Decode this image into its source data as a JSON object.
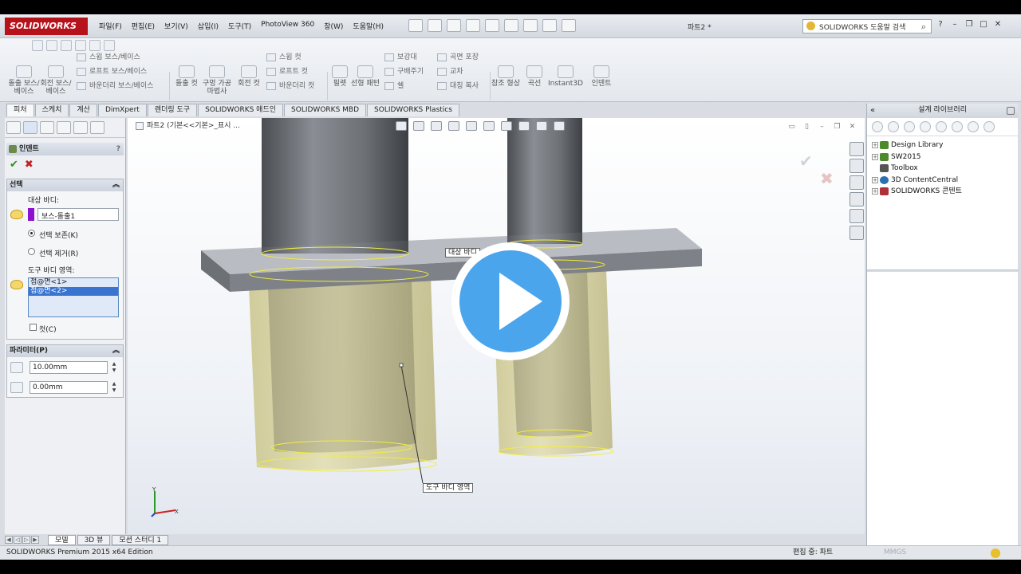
{
  "app": {
    "logo_text": "SOLIDWORKS",
    "doc_title": "파트2 *",
    "search_placeholder": "SOLIDWORKS 도움말 검색"
  },
  "menu": [
    "파일(F)",
    "편집(E)",
    "보기(V)",
    "삽입(I)",
    "도구(T)",
    "PhotoView 360",
    "창(W)",
    "도움말(H)"
  ],
  "ribbon": {
    "big": [
      {
        "label": "돌출 보스/베이스"
      },
      {
        "label": "회전 보스/베이스"
      },
      {
        "label": "돌출 컷"
      },
      {
        "label": "구멍 가공 마법사"
      },
      {
        "label": "회전 컷"
      },
      {
        "label": "필렛"
      },
      {
        "label": "선형 패턴"
      },
      {
        "label": "참조 형상"
      },
      {
        "label": "곡선"
      },
      {
        "label": "Instant3D"
      },
      {
        "label": "인덴트"
      }
    ],
    "small": {
      "sweep_boss": "스윕 보스/베이스",
      "loft_boss": "로프트 보스/베이스",
      "boundary_boss": "바운더리 보스/베이스",
      "sweep_cut": "스윕 컷",
      "loft_cut": "로프트 컷",
      "boundary_cut": "바운더리 컷",
      "draft": "보강대",
      "wrap": "구배주기",
      "shell": "쉘",
      "curve_wrap": "곡면 포장",
      "intersect": "교차",
      "mirror": "대칭 복사"
    }
  },
  "tabs": [
    "피처",
    "스케치",
    "계산",
    "DimXpert",
    "렌더링 도구",
    "SOLIDWORKS 애드인",
    "SOLIDWORKS MBD",
    "SOLIDWORKS Plastics"
  ],
  "property_manager": {
    "title": "인덴트",
    "help": "?",
    "selection": {
      "header": "선택",
      "target_label": "대상 바디:",
      "target_value": "보스-돌출1",
      "keep_label": "선택 보존(K)",
      "remove_label": "선택 제거(R)",
      "tool_label": "도구 바디 영역:",
      "tool_items": [
        "점@면<1>",
        "점@면<2>"
      ],
      "cut_label": "컷(C)"
    },
    "parameters": {
      "header": "파라미터(P)",
      "thickness": "10.00mm",
      "clearance": "0.00mm"
    }
  },
  "viewport": {
    "tree_crumb": "파트2 (기본<<기본>_표시 ...",
    "callout_target": "대상 바디",
    "callout_tool": "도구 바디 영역"
  },
  "bottom_tabs": [
    "모델",
    "3D 뷰",
    "모션 스터디 1"
  ],
  "status": {
    "left": "SOLIDWORKS Premium 2015 x64 Edition",
    "mid": "편집 중: 파트",
    "mnigs": "MMGS"
  },
  "task_pane": {
    "title": "설계 라이브러리",
    "items": [
      {
        "label": "Design Library",
        "color": "#4a8a2a"
      },
      {
        "label": "SW2015",
        "color": "#4a8a2a"
      },
      {
        "label": "Toolbox",
        "color": "#555555"
      },
      {
        "label": "3D ContentCentral",
        "color": "#2a6fb0"
      },
      {
        "label": "SOLIDWORKS 콘텐트",
        "color": "#b0303a"
      }
    ]
  },
  "colors": {
    "logo_red": "#b6121b",
    "tool_body": "#d7d29a",
    "play_blue": "#4aa5ec",
    "selection_purple": "#8a12d0"
  }
}
